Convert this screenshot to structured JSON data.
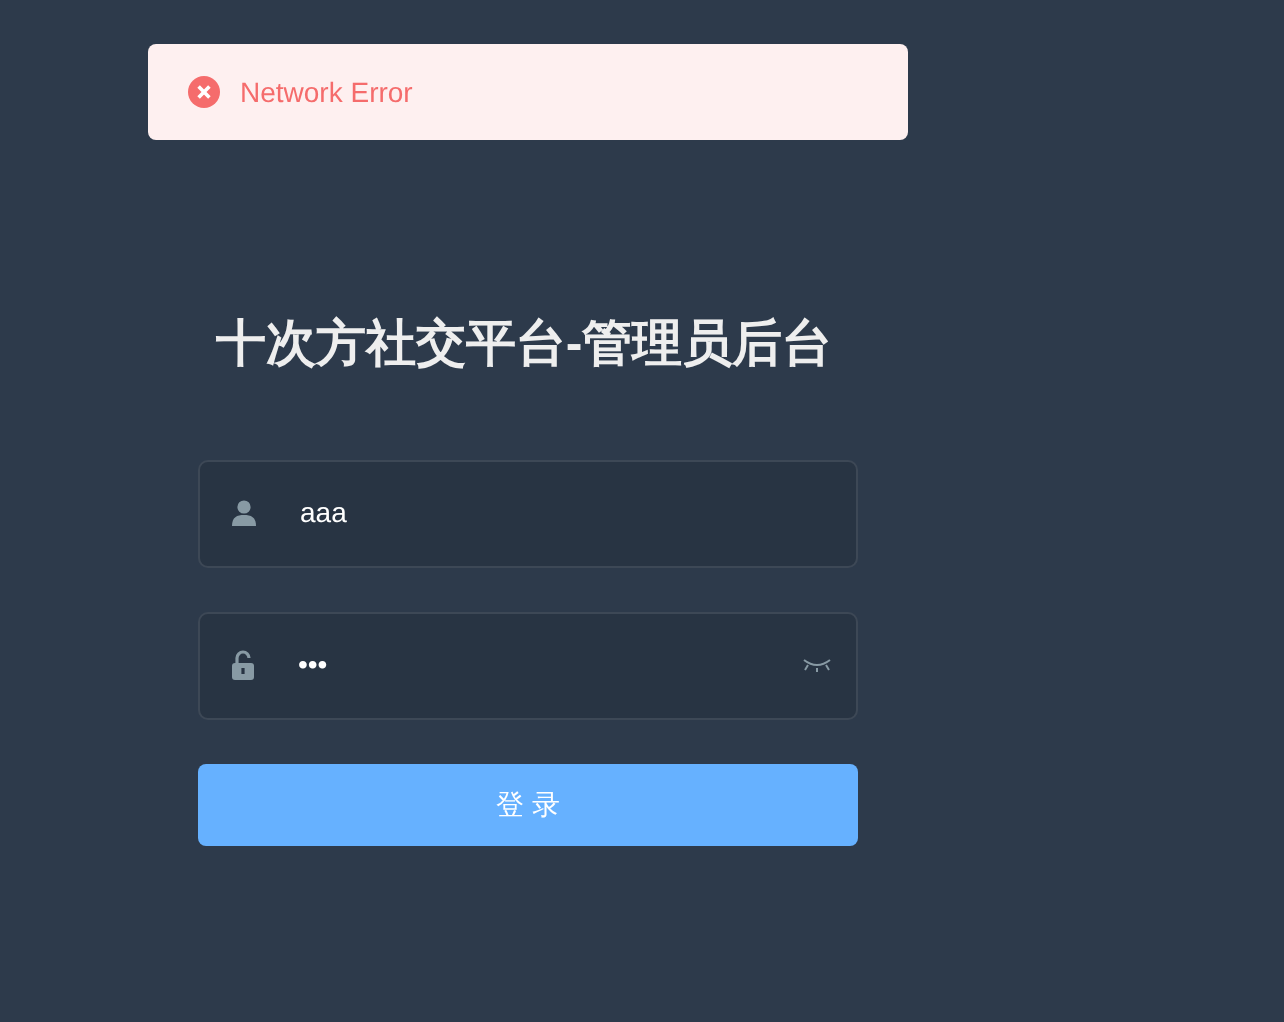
{
  "toast": {
    "kind": "error",
    "message": "Network Error"
  },
  "title": "十次方社交平台-管理员后台",
  "username": {
    "value": "aaa"
  },
  "password": {
    "value": "•••"
  },
  "login_button": "登 录"
}
